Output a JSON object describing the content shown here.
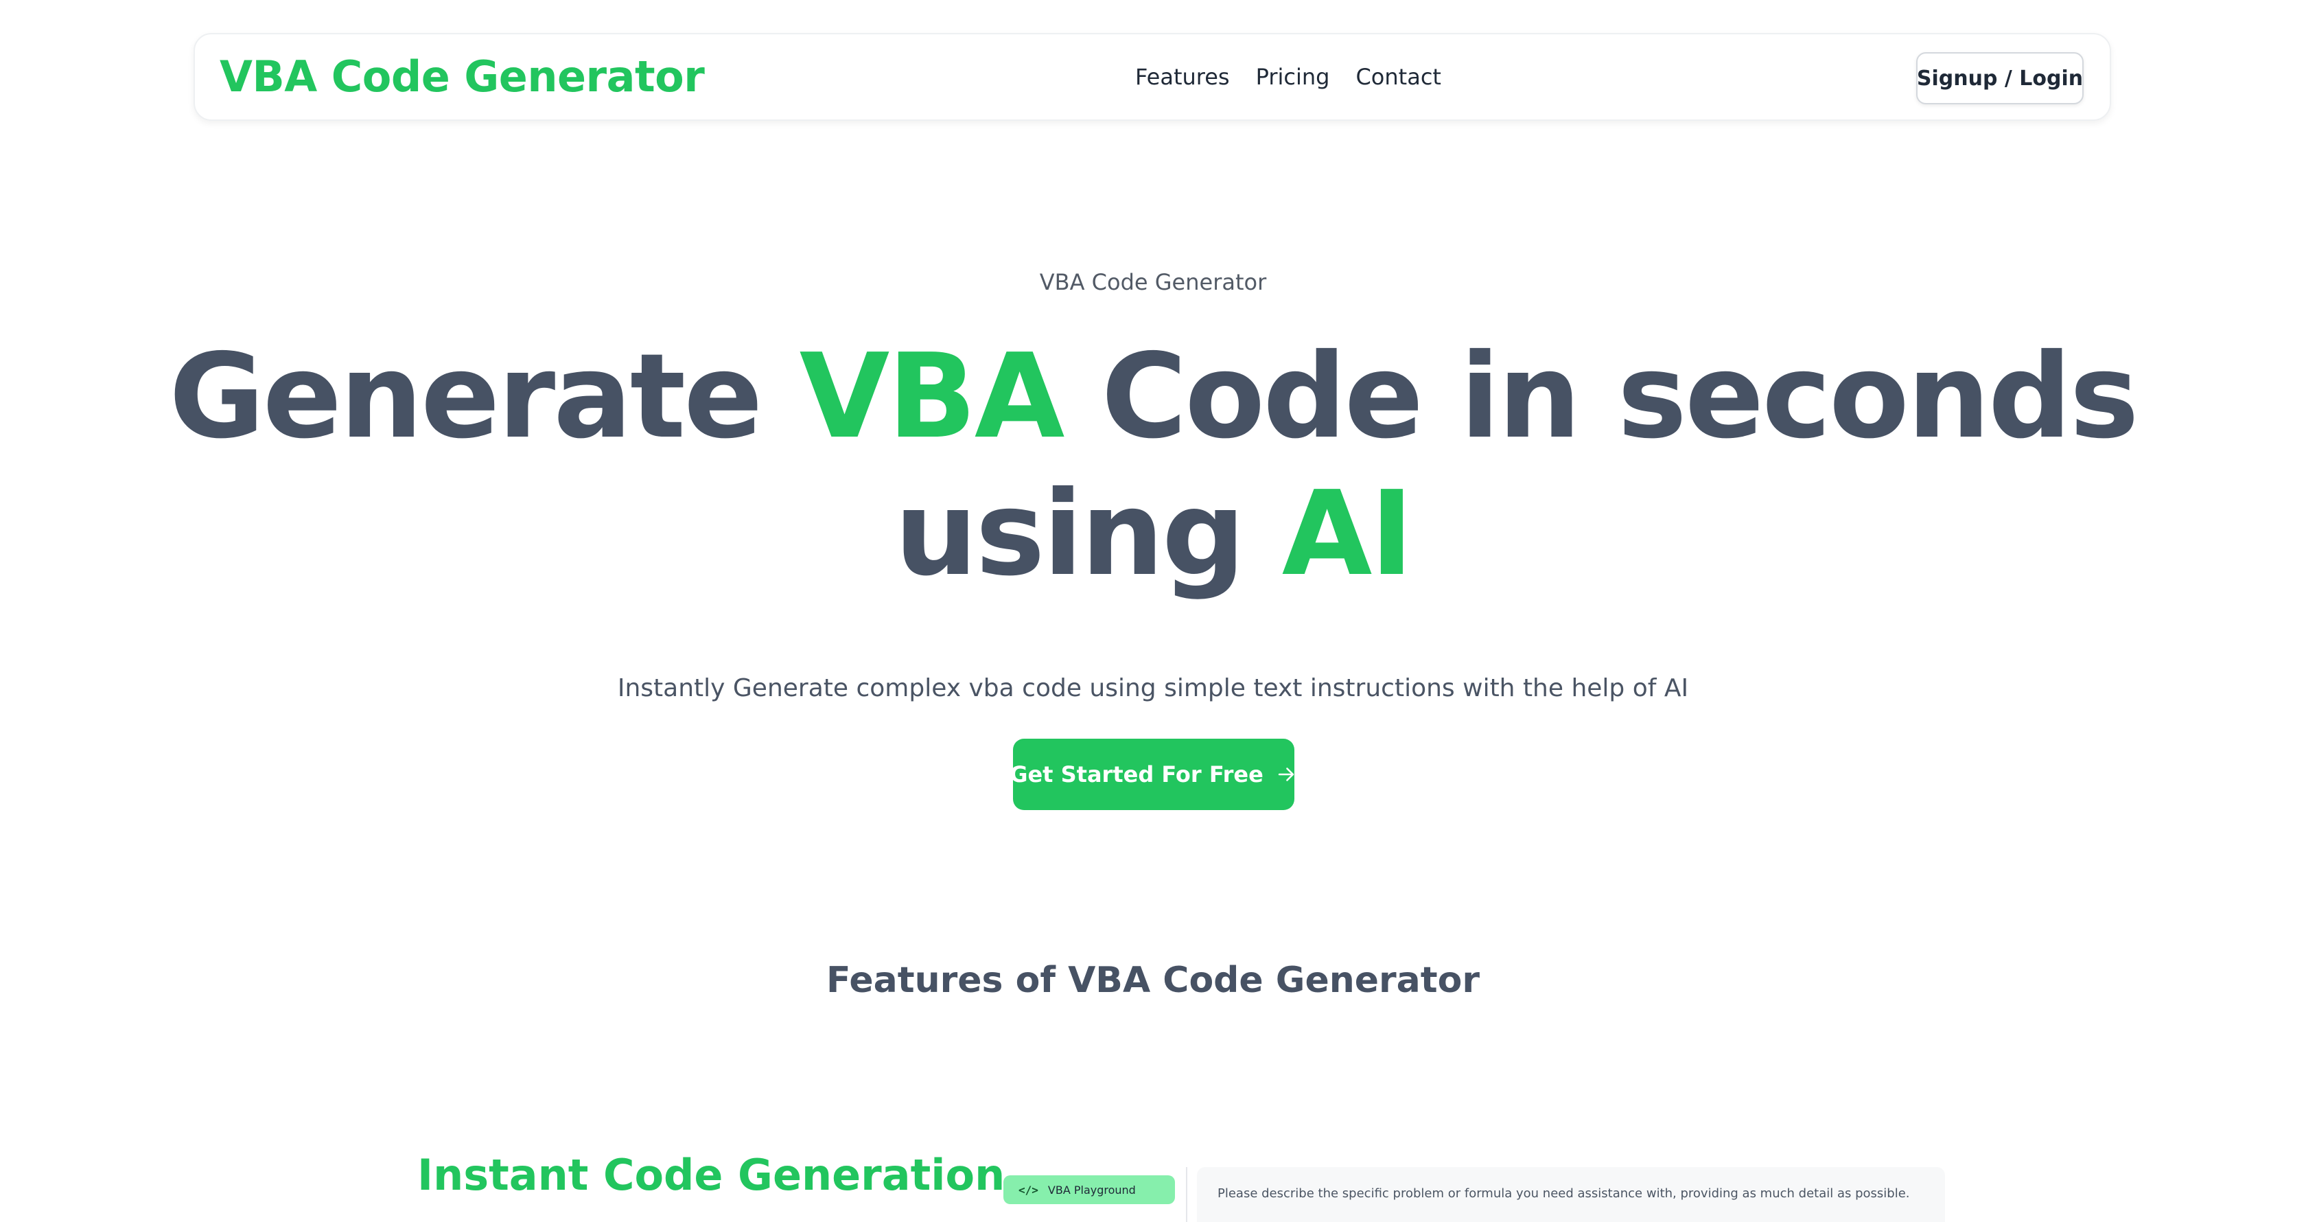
{
  "navbar": {
    "brand": "VBA Code Generator",
    "links": [
      "Features",
      "Pricing",
      "Contact"
    ],
    "login_label": "Signup / Login"
  },
  "hero": {
    "eyebrow": "VBA Code Generator",
    "title_line1_before": "Generate ",
    "title_line1_accent": "VBA",
    "title_line1_after": " Code in seconds",
    "title_line2_before": "using ",
    "title_line2_accent": "AI",
    "subtitle": "Instantly Generate complex vba code using simple text instructions with the help of AI",
    "cta_label": "Get Started For Free",
    "cta_icon": "arrow-right-icon"
  },
  "features": {
    "heading": "Features of VBA Code Generator",
    "first_feature_title": "Instant Code Generation"
  },
  "playground": {
    "sidebar_item_label": "VBA Playground",
    "sidebar_item_icon": "code-icon",
    "prompt_text": "Please describe the specific problem or formula you need assistance with, providing as much detail as possible."
  },
  "colors": {
    "accent": "#22c55e",
    "heading": "#475264",
    "text": "#4a5464",
    "light_accent": "#86efac"
  }
}
